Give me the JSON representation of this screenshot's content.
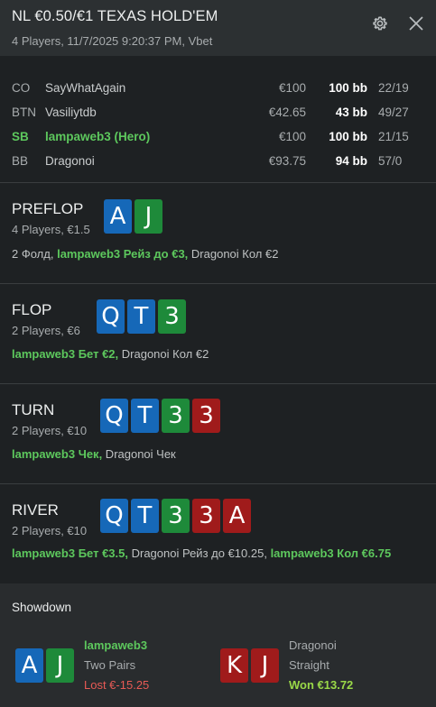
{
  "header": {
    "title": "NL €0.50/€1 TEXAS HOLD'EM",
    "subtitle": "4 Players, 11/7/2025 9:20:37 PM, Vbet",
    "settings_icon": "gear-icon",
    "close_icon": "close-icon"
  },
  "players": [
    {
      "position": "CO",
      "name": "SayWhatAgain",
      "stack": "€100",
      "bb": "100 bb",
      "stats": "22/19",
      "hero": false
    },
    {
      "position": "BTN",
      "name": "Vasiliytdb",
      "stack": "€42.65",
      "bb": "43 bb",
      "stats": "49/27",
      "hero": false
    },
    {
      "position": "SB",
      "name": "lampaweb3 (Hero)",
      "stack": "€100",
      "bb": "100 bb",
      "stats": "21/15",
      "hero": true
    },
    {
      "position": "BB",
      "name": "Dragonoi",
      "stack": "€93.75",
      "bb": "94 bb",
      "stats": "57/0",
      "hero": false
    }
  ],
  "streets": {
    "preflop": {
      "name": "PREFLOP",
      "meta": "4 Players, €1.5",
      "cards": [
        {
          "rank": "A",
          "suit": "blue"
        },
        {
          "rank": "J",
          "suit": "green"
        }
      ],
      "actions": [
        {
          "text": "2 Фолд, ",
          "hero": false
        },
        {
          "text": "lampaweb3 Рейз до €3,",
          "hero": true
        },
        {
          "text": " Dragonoi Кол €2",
          "hero": false
        }
      ]
    },
    "flop": {
      "name": "FLOP",
      "meta": "2 Players, €6",
      "cards": [
        {
          "rank": "Q",
          "suit": "blue"
        },
        {
          "rank": "T",
          "suit": "blue"
        },
        {
          "rank": "3",
          "suit": "green"
        }
      ],
      "actions": [
        {
          "text": "lampaweb3 Бет €2,",
          "hero": true
        },
        {
          "text": " Dragonoi Кол €2",
          "hero": false
        }
      ]
    },
    "turn": {
      "name": "TURN",
      "meta": "2 Players, €10",
      "cards": [
        {
          "rank": "Q",
          "suit": "blue"
        },
        {
          "rank": "T",
          "suit": "blue"
        },
        {
          "rank": "3",
          "suit": "green"
        },
        {
          "rank": "3",
          "suit": "red"
        }
      ],
      "actions": [
        {
          "text": "lampaweb3 Чек,",
          "hero": true
        },
        {
          "text": " Dragonoi Чек",
          "hero": false
        }
      ]
    },
    "river": {
      "name": "RIVER",
      "meta": "2 Players, €10",
      "cards": [
        {
          "rank": "Q",
          "suit": "blue"
        },
        {
          "rank": "T",
          "suit": "blue"
        },
        {
          "rank": "3",
          "suit": "green"
        },
        {
          "rank": "3",
          "suit": "red"
        },
        {
          "rank": "A",
          "suit": "red"
        }
      ],
      "actions": [
        {
          "text": "lampaweb3 Бет €3.5,",
          "hero": true
        },
        {
          "text": " Dragonoi Рейз до €10.25, ",
          "hero": false
        },
        {
          "text": "lampaweb3 Кол €6.75",
          "hero": true
        }
      ]
    }
  },
  "showdown": {
    "title": "Showdown",
    "hands": [
      {
        "name": "lampaweb3",
        "hand": "Two Pairs",
        "result": "Lost €-15.25",
        "outcome": "lost",
        "hero": true,
        "cards": [
          {
            "rank": "A",
            "suit": "blue"
          },
          {
            "rank": "J",
            "suit": "green"
          }
        ]
      },
      {
        "name": "Dragonoi",
        "hand": "Straight",
        "result": "Won €13.72",
        "outcome": "won",
        "hero": false,
        "cards": [
          {
            "rank": "K",
            "suit": "red"
          },
          {
            "rank": "J",
            "suit": "red"
          }
        ]
      }
    ]
  },
  "colors": {
    "background": "#1e2123",
    "header": "#2c3032",
    "hero_green": "#5dc85d",
    "card_blue": "#1668b8",
    "card_green": "#1e8a3a",
    "card_red": "#a01b1b",
    "lost_red": "#e85a55",
    "won_green": "#9ad948"
  }
}
